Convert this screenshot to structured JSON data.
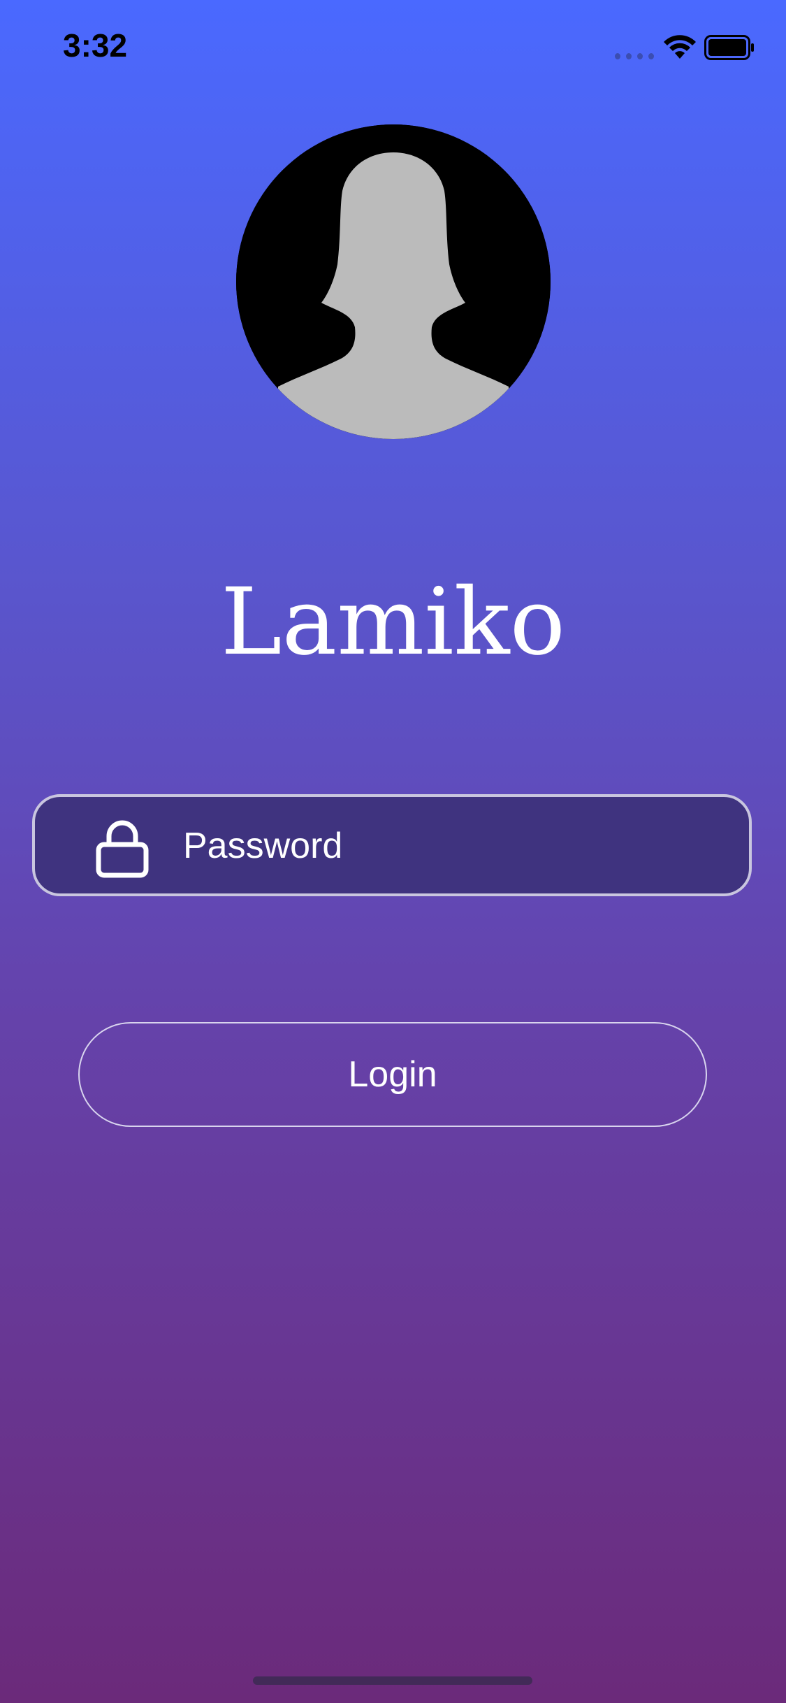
{
  "status_bar": {
    "time": "3:32",
    "icons": [
      "signal-icon",
      "wifi-icon",
      "battery-icon"
    ]
  },
  "avatar": {
    "icon": "user-silhouette-icon"
  },
  "app": {
    "title": "Lamiko"
  },
  "login_form": {
    "password": {
      "value": "",
      "placeholder": "Password",
      "icon": "lock-icon"
    },
    "login_label": "Login"
  },
  "colors": {
    "background_top": "#4a69ff",
    "background_bottom": "#6b2a7a",
    "field_fill": "#3f337f",
    "field_border": "#c9c6df",
    "text": "#ffffff"
  }
}
